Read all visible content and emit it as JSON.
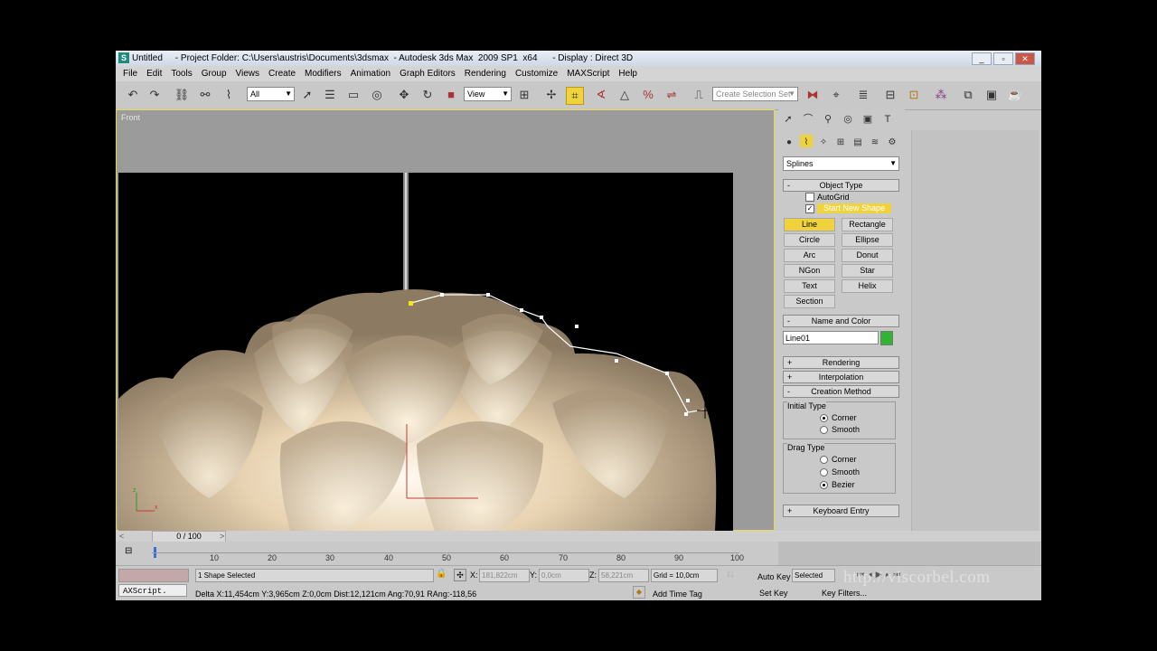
{
  "titlebar": {
    "title": "Untitled     - Project Folder: C:\\Users\\austris\\Documents\\3dsmax  - Autodesk 3ds Max  2009 SP1  x64      - Display : Direct 3D",
    "controls": [
      "_",
      "▫",
      "✕"
    ]
  },
  "menu": [
    "File",
    "Edit",
    "Tools",
    "Group",
    "Views",
    "Create",
    "Modifiers",
    "Animation",
    "Graph Editors",
    "Rendering",
    "Customize",
    "MAXScript",
    "Help"
  ],
  "toolbar": {
    "selection_filter": "All",
    "reference_coord": "View",
    "named_selection_placeholder": "Create Selection Set"
  },
  "viewport": {
    "label": "Front"
  },
  "command_panel": {
    "category_dropdown": "Splines",
    "object_type": {
      "title": "Object Type",
      "autogrid_label": "AutoGrid",
      "start_new_shape_label": "Start New Shape",
      "buttons": [
        "Line",
        "Rectangle",
        "Circle",
        "Ellipse",
        "Arc",
        "Donut",
        "NGon",
        "Star",
        "Text",
        "Helix",
        "Section"
      ],
      "active": "Line"
    },
    "name_and_color": {
      "title": "Name and Color",
      "name": "Line01",
      "color": "#2fb52f"
    },
    "rendering_title": "Rendering",
    "interpolation_title": "Interpolation",
    "creation_method": {
      "title": "Creation Method",
      "initial_type_label": "Initial Type",
      "initial_options": [
        "Corner",
        "Smooth"
      ],
      "drag_type_label": "Drag Type",
      "drag_options": [
        "Corner",
        "Smooth",
        "Bezier"
      ]
    },
    "keyboard_entry_title": "Keyboard Entry"
  },
  "timeline": {
    "frame": "0 / 100",
    "ticks": [
      "10",
      "20",
      "30",
      "40",
      "50",
      "60",
      "70",
      "80",
      "90",
      "100"
    ]
  },
  "status": {
    "selection": "1 Shape Selected",
    "maxscript_label": "AXScript.",
    "prompt": "Delta X:11,454cm  Y:3,965cm  Z:0,0cm  Dist:12,121cm  Ang:70,91  RAng:-118,56",
    "x_label": "X:",
    "x_value": "181,822cm",
    "y_label": "Y:",
    "y_value": "0,0cm",
    "z_label": "Z:",
    "z_value": "58,221cm",
    "grid": "Grid = 10,0cm",
    "add_time_tag": "Add Time Tag",
    "auto_key": "Auto Key",
    "selected": "Selected",
    "set_key": "Set Key",
    "key_filters": "Key Filters...",
    "watermark": "http://viscorbel.com"
  },
  "colors": {
    "accent": "#f0d23c",
    "viewport_border": "#e8d84a",
    "spline": "#ffffff",
    "name_swatch": "#2fb52f"
  }
}
